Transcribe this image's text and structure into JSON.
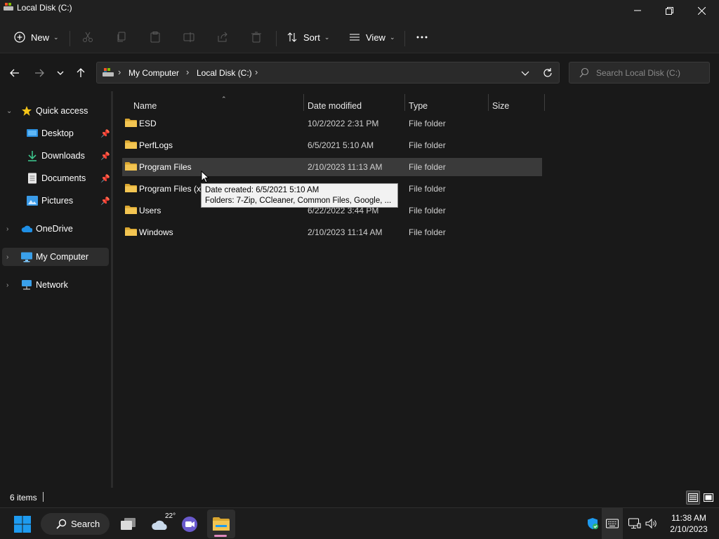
{
  "window": {
    "title": "Local Disk (C:)"
  },
  "commandbar": {
    "new_label": "New",
    "sort_label": "Sort",
    "view_label": "View"
  },
  "address": {
    "crumbs": [
      "My Computer",
      "Local Disk (C:)"
    ]
  },
  "search": {
    "placeholder": "Search Local Disk (C:)"
  },
  "navpane": {
    "items": [
      {
        "label": "Quick access"
      },
      {
        "label": "Desktop"
      },
      {
        "label": "Downloads"
      },
      {
        "label": "Documents"
      },
      {
        "label": "Pictures"
      },
      {
        "label": "OneDrive"
      },
      {
        "label": "My Computer"
      },
      {
        "label": "Network"
      }
    ]
  },
  "columns": {
    "name": "Name",
    "date": "Date modified",
    "type": "Type",
    "size": "Size"
  },
  "files": [
    {
      "name": "ESD",
      "date": "10/2/2022 2:31 PM",
      "type": "File folder"
    },
    {
      "name": "PerfLogs",
      "date": "6/5/2021 5:10 AM",
      "type": "File folder"
    },
    {
      "name": "Program Files",
      "date": "2/10/2023 11:13 AM",
      "type": "File folder"
    },
    {
      "name": "Program Files (x86)",
      "date": "",
      "type": "File folder"
    },
    {
      "name": "Users",
      "date": "6/22/2022 3:44 PM",
      "type": "File folder"
    },
    {
      "name": "Windows",
      "date": "2/10/2023 11:14 AM",
      "type": "File folder"
    }
  ],
  "tooltip": {
    "line1": "Date created: 6/5/2021 5:10 AM",
    "line2": "Folders: 7-Zip, CCleaner, Common Files, Google, ..."
  },
  "status": {
    "item_count": "6 items"
  },
  "taskbar": {
    "search_label": "Search",
    "temperature": "22°",
    "time": "11:38 AM",
    "date": "2/10/2023"
  },
  "colors": {
    "folder": "#f0c04a",
    "accent": "#0a84d6",
    "hover_row": "#3a3a3a"
  }
}
